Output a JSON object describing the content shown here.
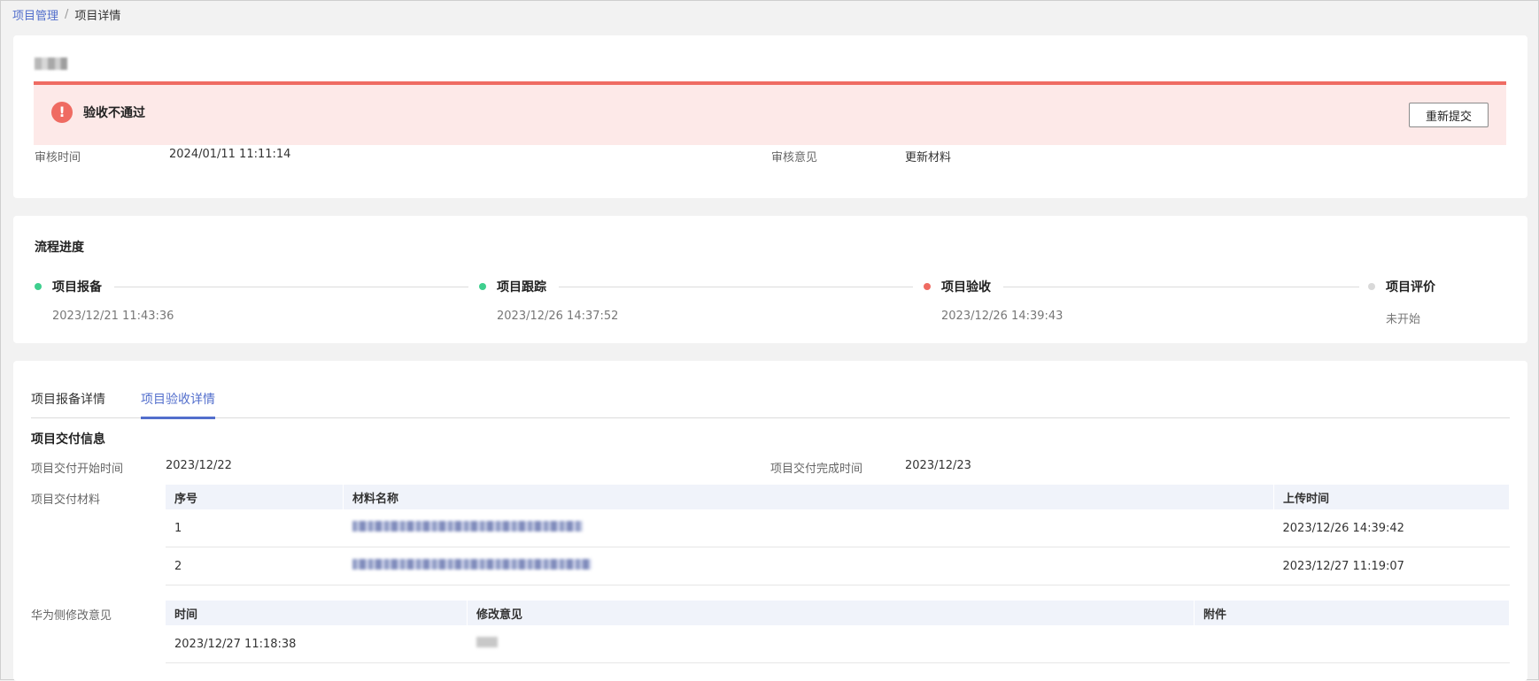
{
  "breadcrumb": {
    "parent": "项目管理",
    "separator": "/",
    "current": "项目详情"
  },
  "status": {
    "alert_text": "验收不通过",
    "alert_icon": "!",
    "resubmit_label": "重新提交",
    "review_time_label": "审核时间",
    "review_time": "2024/01/11 11:11:14",
    "review_opinion_label": "审核意见",
    "review_opinion": "更新材料"
  },
  "process": {
    "title": "流程进度",
    "steps": [
      {
        "name": "项目报备",
        "time": "2023/12/21 11:43:36",
        "color": "#3ecf8e"
      },
      {
        "name": "项目跟踪",
        "time": "2023/12/26 14:37:52",
        "color": "#3ecf8e"
      },
      {
        "name": "项目验收",
        "time": "2023/12/26 14:39:43",
        "color": "#ef6b62"
      },
      {
        "name": "项目评价",
        "time": "未开始",
        "color": "#d9d9d9"
      }
    ]
  },
  "detail": {
    "tabs": [
      "项目报备详情",
      "项目验收详情"
    ],
    "active_tab": 1,
    "section_title": "项目交付信息",
    "start_label": "项目交付开始时间",
    "start_value": "2023/12/22",
    "end_label": "项目交付完成时间",
    "end_value": "2023/12/23",
    "materials_label": "项目交付材料",
    "materials_headers": [
      "序号",
      "材料名称",
      "上传时间"
    ],
    "materials_rows": [
      {
        "index": "1",
        "upload_time": "2023/12/26 14:39:42"
      },
      {
        "index": "2",
        "upload_time": "2023/12/27 11:19:07"
      }
    ],
    "feedback_label": "华为侧修改意见",
    "feedback_headers": [
      "时间",
      "修改意见",
      "附件"
    ],
    "feedback_rows": [
      {
        "time": "2023/12/27 11:18:38"
      }
    ]
  },
  "colors": {
    "accent": "#526ecc",
    "error": "#ef6b62",
    "done": "#3ecf8e",
    "pending": "#d9d9d9"
  }
}
